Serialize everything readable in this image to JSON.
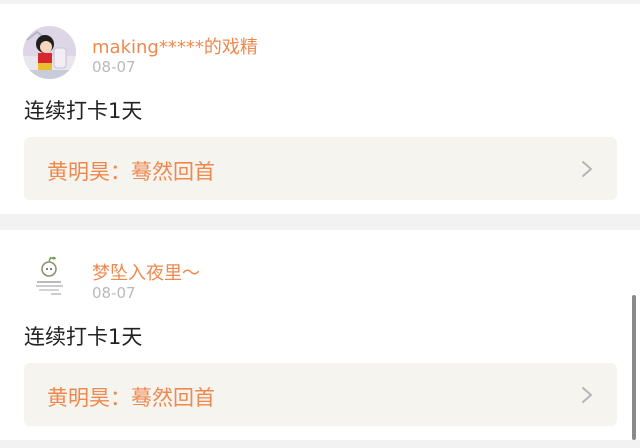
{
  "posts": [
    {
      "username": "making*****的戏精",
      "date": "08-07",
      "text": "连续打卡1天",
      "link": {
        "author": "黄明昊",
        "separator": "：",
        "title": "蓦然回首"
      }
    },
    {
      "username": "梦坠入夜里～",
      "date": "08-07",
      "text": "连续打卡1天",
      "link": {
        "author": "黄明昊",
        "separator": "：",
        "title": "蓦然回首"
      }
    }
  ],
  "colors": {
    "accent": "#f0884e",
    "date": "#b9b9b9",
    "link_bg": "#f5f4ef",
    "background": "#f2f2f2"
  }
}
